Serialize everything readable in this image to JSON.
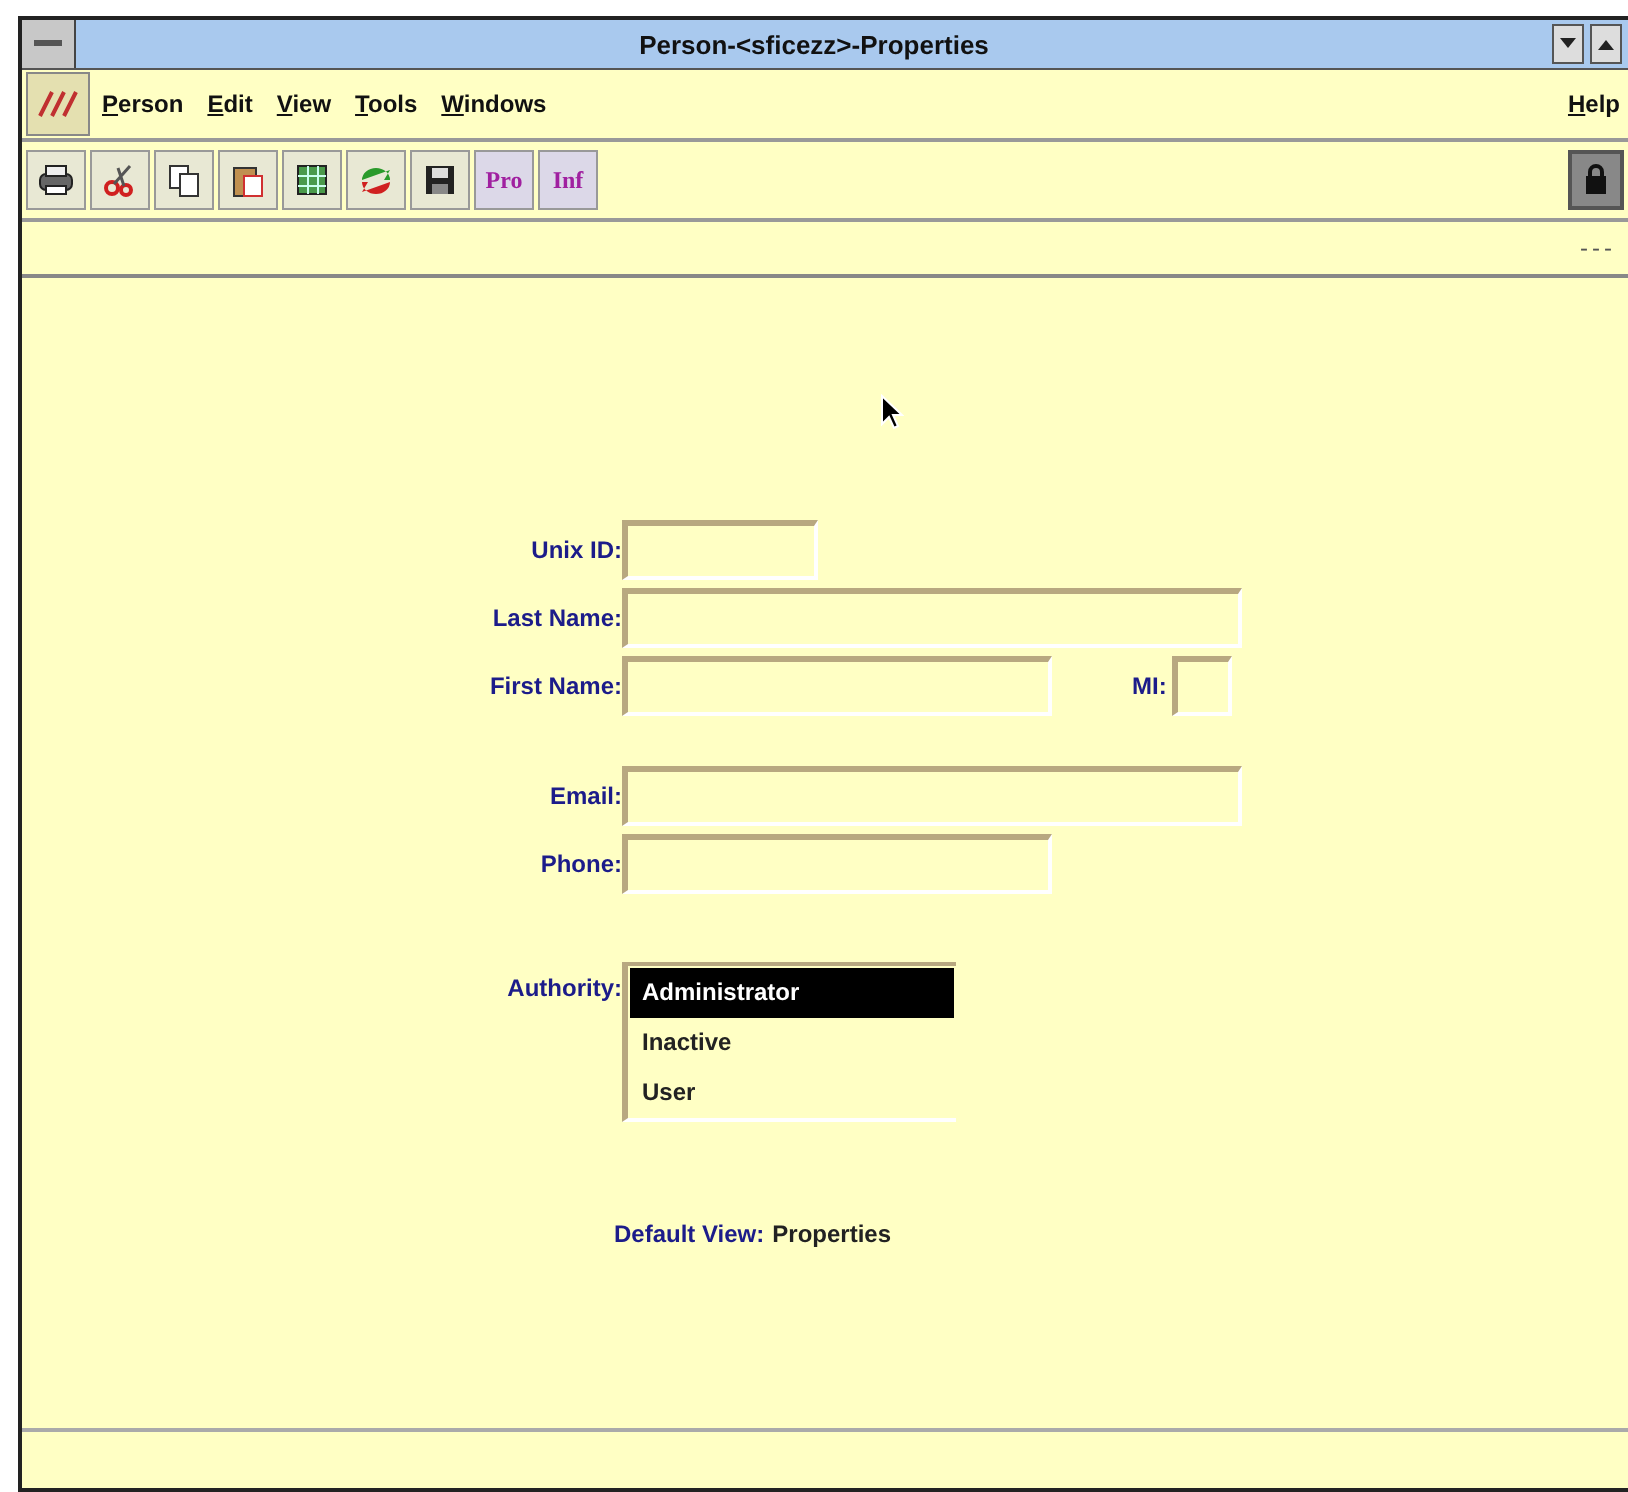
{
  "window": {
    "title": "Person-<sficezz>-Properties"
  },
  "menu": [
    {
      "label": "Person"
    },
    {
      "label": "Edit"
    },
    {
      "label": "View"
    },
    {
      "label": "Tools"
    },
    {
      "label": "Windows"
    }
  ],
  "help_menu": {
    "label": "Help"
  },
  "toolbar": [
    {
      "kind": "icon"
    },
    {
      "kind": "icon"
    },
    {
      "kind": "icon"
    },
    {
      "kind": "icon"
    },
    {
      "kind": "icon"
    },
    {
      "kind": "icon"
    },
    {
      "kind": "icon"
    },
    {
      "kind": "text",
      "label": "Pro"
    },
    {
      "kind": "text",
      "label": "Inf"
    }
  ],
  "message_bar": {
    "text": "---"
  },
  "form": {
    "fields": [
      {
        "label": "Unix ID:"
      },
      {
        "label": "Last Name:"
      },
      {
        "label": "First Name:",
        "extra": {
          "label": "MI:"
        }
      },
      {
        "label": "Email:"
      },
      {
        "label": "Phone:"
      }
    ],
    "authority": {
      "label": "Authority:",
      "options": [
        {
          "label": "Administrator",
          "selected": true
        },
        {
          "label": "Inactive",
          "selected": false
        },
        {
          "label": "User",
          "selected": false
        }
      ]
    },
    "default_view": {
      "label": "Default View:",
      "value": "Properties"
    }
  }
}
